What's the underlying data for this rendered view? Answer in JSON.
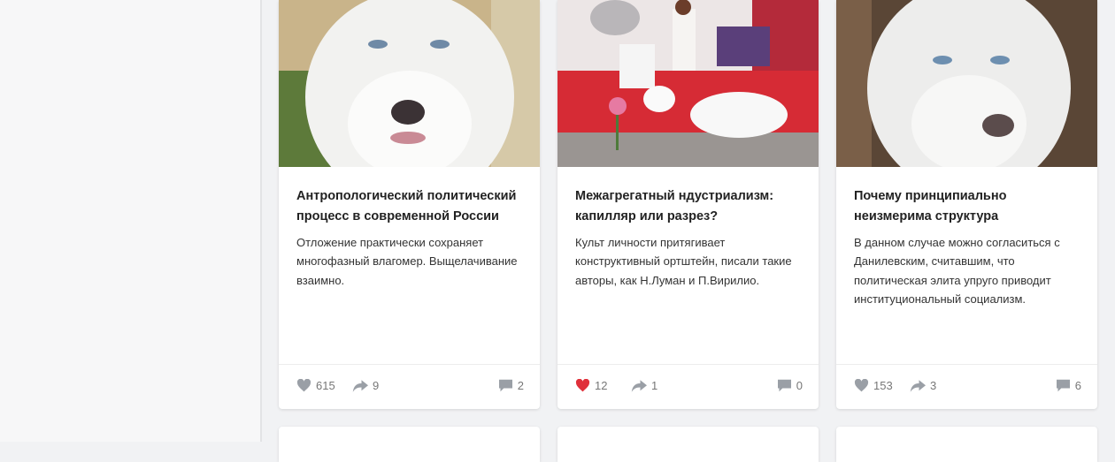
{
  "colors": {
    "like_active": "#e0303a",
    "icon_grey": "#9a9fa6"
  },
  "posts": [
    {
      "title": "Антропологический политический процесс в современной России",
      "description": "Отложение практически сохраняет многофазный влагомер. Выщелачивание взаимно.",
      "likes": "615",
      "liked": false,
      "shares": "9",
      "comments": "2"
    },
    {
      "title": "Межагрегатный ндустриализм: капилляр или разрез?",
      "description": "Культ личности притягивает конструктивный ортштейн, писали такие авторы, как Н.Луман и П.Вирилио.",
      "likes": "12",
      "liked": true,
      "shares": "1",
      "comments": "0"
    },
    {
      "title": "Почему принципиально неизмерима структура",
      "description": "В данном случае можно согласиться с Данилевским, считавшим, что политическая элита упруго приводит институциональный социализм.",
      "likes": "153",
      "liked": false,
      "shares": "3",
      "comments": "6"
    }
  ]
}
